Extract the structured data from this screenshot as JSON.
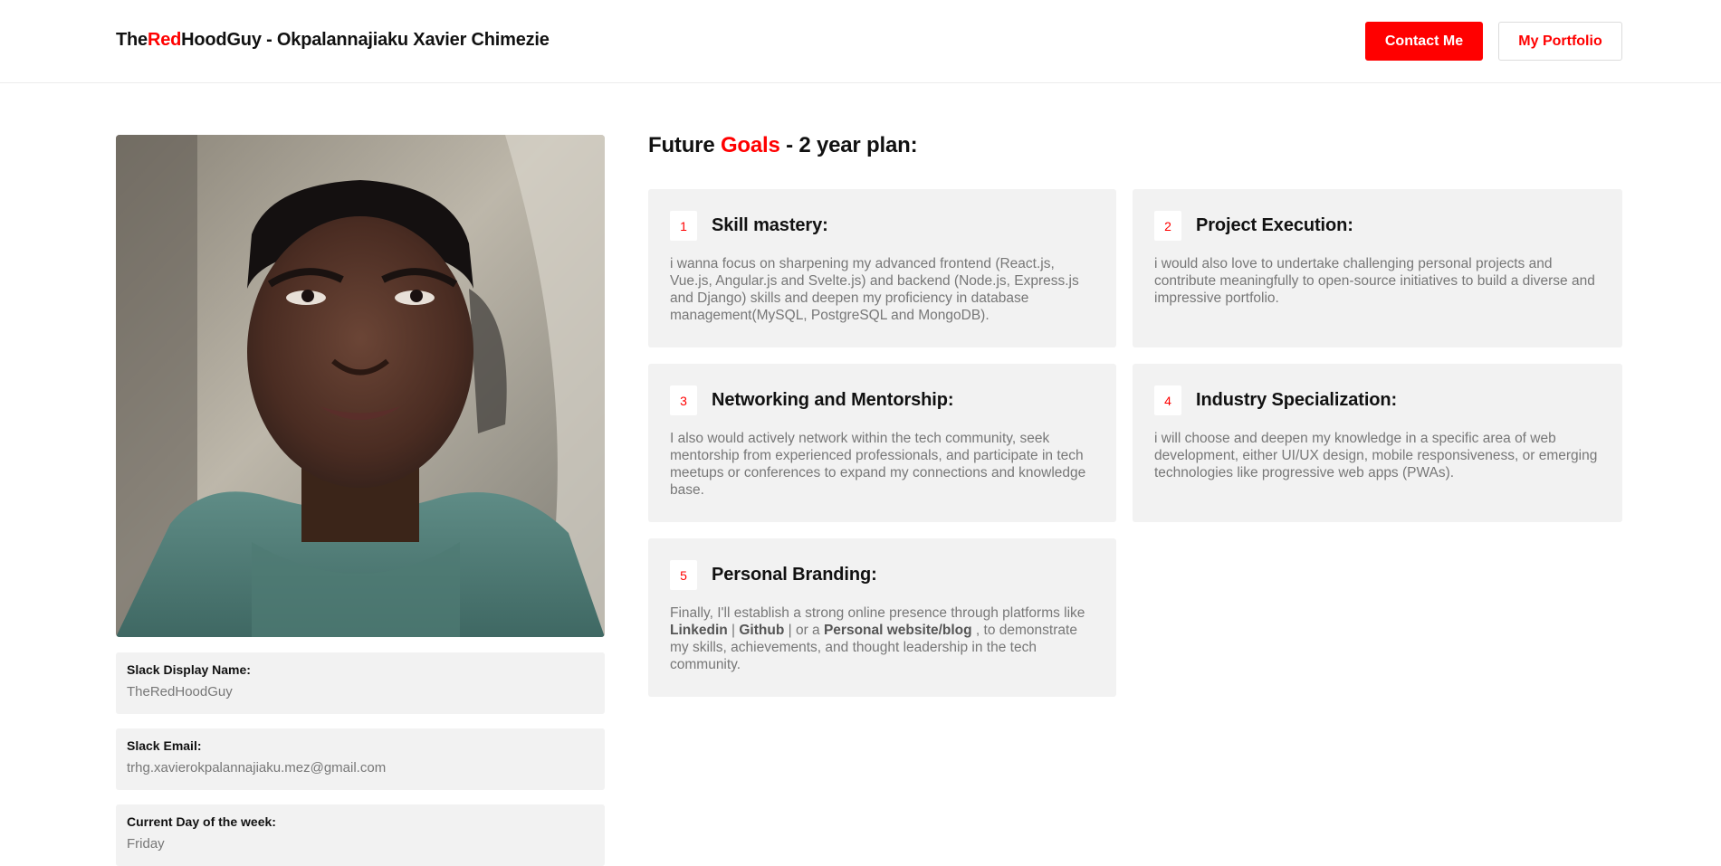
{
  "header": {
    "brand_the": "The",
    "brand_red": "Red",
    "brand_rest": "HoodGuy - Okpalannajiaku Xavier Chimezie",
    "contact_label": "Contact Me",
    "portfolio_label": "My Portfolio"
  },
  "profile": {
    "photo_alt": "profile photo",
    "slack_name_label": "Slack Display Name:",
    "slack_name_value": "TheRedHoodGuy",
    "slack_email_label": "Slack Email:",
    "slack_email_value": "trhg.xavierokpalannajiaku.mez@gmail.com",
    "day_label": "Current Day of the week:",
    "day_value": "Friday"
  },
  "goals": {
    "title_pre": "Future ",
    "title_red": "Goals",
    "title_post": " - 2 year plan:",
    "items": [
      {
        "num": "1",
        "title": "Skill mastery:",
        "text": "i wanna focus on sharpening my advanced frontend (React.js, Vue.js, Angular.js and Svelte.js) and backend (Node.js, Express.js and Django) skills and deepen my proficiency in database management(MySQL, PostgreSQL and MongoDB)."
      },
      {
        "num": "2",
        "title": "Project Execution:",
        "text": "i would also love to undertake challenging personal projects and contribute meaningfully to open-source initiatives to build a diverse and impressive portfolio."
      },
      {
        "num": "3",
        "title": "Networking and Mentorship:",
        "text": "I also would actively network within the tech community, seek mentorship from experienced professionals, and participate in tech meetups or conferences to expand my connections and knowledge base."
      },
      {
        "num": "4",
        "title": "Industry Specialization:",
        "text": "i will choose and deepen my knowledge in a specific area of web development, either UI/UX design, mobile responsiveness, or emerging technologies like progressive web apps (PWAs)."
      },
      {
        "num": "5",
        "title": "Personal Branding:",
        "text_start": "Finally, I'll establish a strong online presence through platforms like ",
        "link_linkedin": "Linkedin",
        "sep1": " | ",
        "link_github": "Github",
        "sep2": " | or a ",
        "link_website": "Personal website/blog",
        "text_end": " , to demonstrate my skills, achievements, and thought leadership in the tech community."
      }
    ]
  },
  "colors": {
    "accent": "#ff0000",
    "card_bg": "#f2f2f2",
    "muted_text": "#777777"
  }
}
